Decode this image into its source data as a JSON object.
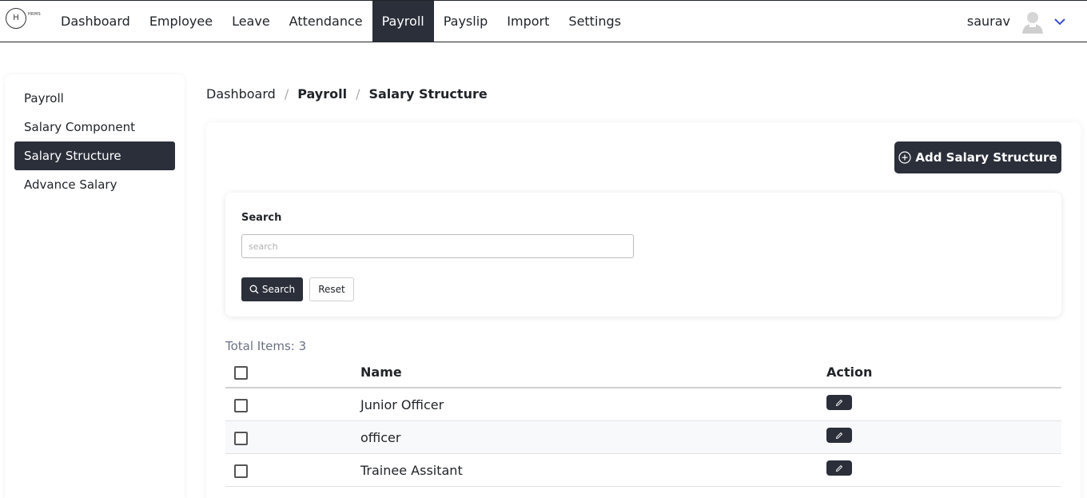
{
  "brand": {
    "letter": "H",
    "sub": "HRMS"
  },
  "nav": {
    "items": [
      "Dashboard",
      "Employee",
      "Leave",
      "Attendance",
      "Payroll",
      "Payslip",
      "Import",
      "Settings"
    ],
    "active_index": 4
  },
  "user": {
    "name": "saurav"
  },
  "sidebar": {
    "items": [
      "Payroll",
      "Salary Component",
      "Salary Structure",
      "Advance Salary"
    ],
    "active_index": 2
  },
  "breadcrumb": [
    "Dashboard",
    "Payroll",
    "Salary Structure"
  ],
  "toolbar": {
    "add_label": "Add Salary Structure"
  },
  "search": {
    "label": "Search",
    "placeholder": "search",
    "value": "",
    "search_button": "Search",
    "reset_button": "Reset"
  },
  "table": {
    "total_label": "Total Items: 3",
    "columns": {
      "name": "Name",
      "action": "Action"
    },
    "rows": [
      {
        "name": "Junior Officer"
      },
      {
        "name": "officer"
      },
      {
        "name": "Trainee Assitant"
      }
    ]
  },
  "colors": {
    "dark": "#2b2f3a",
    "chevron": "#3d4fd6",
    "muted": "#6a7285"
  }
}
